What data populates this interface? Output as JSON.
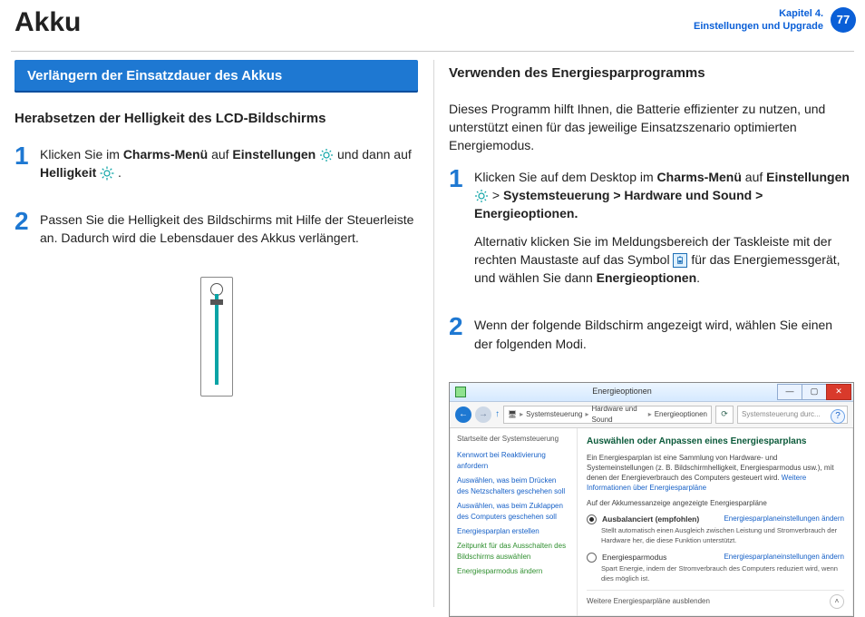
{
  "header": {
    "title": "Akku",
    "chapter_line1": "Kapitel 4.",
    "chapter_line2": "Einstellungen und Upgrade",
    "page_number": "77"
  },
  "left": {
    "blue_heading": "Verlängern der Einsatzdauer des Akkus",
    "subheading": "Herabsetzen der Helligkeit des LCD-Bildschirms",
    "step1": {
      "num": "1",
      "t1": "Klicken Sie im ",
      "b1": "Charms-Menü",
      "t2": " auf ",
      "b2": "Einstellungen",
      "t3": " und dann auf ",
      "b3": "Helligkeit",
      "t4": " ."
    },
    "step2": {
      "num": "2",
      "text": "Passen Sie die Helligkeit des Bildschirms mit Hilfe der Steuerleiste an. Dadurch wird die Lebensdauer des Akkus verlängert."
    }
  },
  "right": {
    "subheading": "Verwenden des Energiesparprogramms",
    "intro": "Dieses Programm hilft Ihnen, die Batterie effizienter zu nutzen, und unterstützt einen für das jeweilige Einsatzszenario optimierten Energiemodus.",
    "step1": {
      "num": "1",
      "t1": "Klicken Sie auf dem Desktop im ",
      "b1": "Charms-Menü",
      "t2": " auf ",
      "b2": "Einstellungen",
      "t3": " > ",
      "b3": "Systemsteuerung > Hardware und Sound > Energieoptionen.",
      "alt1": "Alternativ klicken Sie im Meldungsbereich der Taskleiste mit der rechten Maustaste auf das Symbol ",
      "alt2": " für das Energiemessgerät, und wählen Sie dann ",
      "alt_b": "Energieoptionen",
      "alt_end": "."
    },
    "step2": {
      "num": "2",
      "text": "Wenn der folgende Bildschirm angezeigt wird, wählen Sie einen der folgenden Modi."
    }
  },
  "eo": {
    "title": "Energieoptionen",
    "breadcrumb": {
      "b1": "Systemsteuerung",
      "b2": "Hardware und Sound",
      "b3": "Energieoptionen"
    },
    "search_placeholder": "Systemsteuerung durc...",
    "side": {
      "hdr": "Startseite der Systemsteuerung",
      "l1": "Kennwort bei Reaktivierung anfordern",
      "l2": "Auswählen, was beim Drücken des Netzschalters geschehen soll",
      "l3": "Auswählen, was beim Zuklappen des Computers geschehen soll",
      "l4": "Energiesparplan erstellen",
      "l5": "Zeitpunkt für das Ausschalten des Bildschirms auswählen",
      "l6": "Energiesparmodus ändern"
    },
    "main": {
      "heading": "Auswählen oder Anpassen eines Energiesparplans",
      "desc": "Ein Energiesparplan ist eine Sammlung von Hardware- und Systemeinstellungen (z. B. Bildschirmhelligkeit, Energiesparmodus usw.), mit denen der Energieverbrauch des Computers gesteuert wird. ",
      "more": "Weitere Informationen über Energiesparpläne",
      "shown": "Auf der Akkumessanzeige angezeigte Energiesparpläne",
      "plan1": {
        "label": "Ausbalanciert (empfohlen)",
        "link": "Energiesparplaneinstellungen ändern",
        "desc": "Stellt automatisch einen Ausgleich zwischen Leistung und Stromverbrauch der Hardware her, die diese Funktion unterstützt."
      },
      "plan2": {
        "label": "Energiesparmodus",
        "link": "Energiesparplaneinstellungen ändern",
        "desc": "Spart Energie, indem der Stromverbrauch des Computers reduziert wird, wenn dies möglich ist."
      },
      "footer": "Weitere Energiesparpläne ausblenden"
    }
  }
}
